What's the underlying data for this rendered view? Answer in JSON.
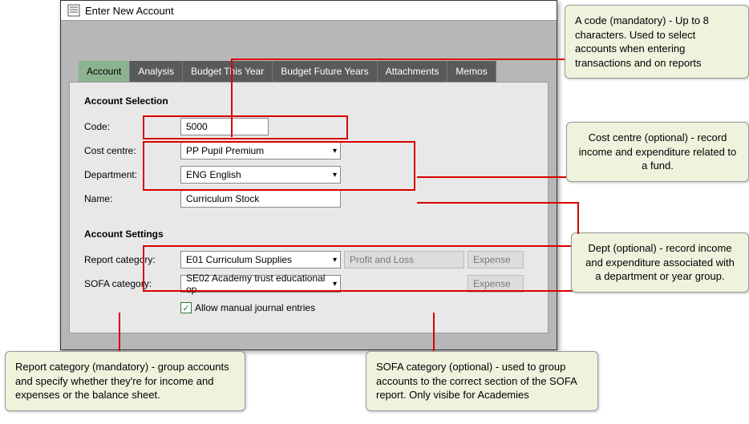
{
  "window": {
    "title": "Enter New Account"
  },
  "tabs": {
    "account": "Account",
    "analysis": "Analysis",
    "budget_this_year": "Budget This Year",
    "budget_future_years": "Budget Future Years",
    "attachments": "Attachments",
    "memos": "Memos"
  },
  "sections": {
    "selection": "Account Selection",
    "settings": "Account Settings"
  },
  "labels": {
    "code": "Code:",
    "cost_centre": "Cost centre:",
    "department": "Department:",
    "name": "Name:",
    "report_category": "Report category:",
    "sofa_category": "SOFA category:",
    "allow_manual": "Allow manual journal entries"
  },
  "values": {
    "code": "5000",
    "cost_centre": "PP Pupil Premium",
    "department": "ENG English",
    "name": "Curriculum Stock",
    "report_category": "E01 Curriculum Supplies",
    "sofa_category": "SE02 Academy trust educational op",
    "report_type": "Profit and Loss",
    "report_expense": "Expense",
    "sofa_expense": "Expense",
    "allow_manual_checked": "✓"
  },
  "callouts": {
    "code": "A code (mandatory) - Up to 8 characters.\nUsed to select accounts when entering transactions and on reports",
    "cost_centre": "Cost centre (optional)  - record income and expenditure related to a fund.",
    "department": "Dept (optional) - record income and expenditure associated with a department or year group.",
    "report_category": "Report category (mandatory) - group accounts and specify whether they're for income and expenses or the balance sheet.",
    "sofa_category": "SOFA category (optional)  - used to group accounts to the correct section of the SOFA report.\nOnly visibe for Academies"
  }
}
